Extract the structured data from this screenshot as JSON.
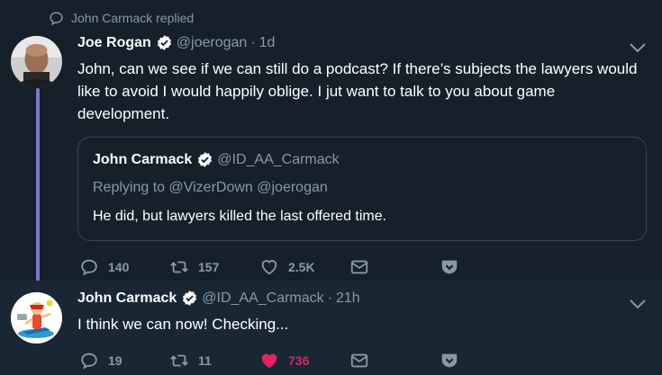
{
  "context": {
    "icon": "reply-bubble-icon",
    "text": "John Carmack replied"
  },
  "tweet1": {
    "name": "Joe Rogan",
    "handle": "@joerogan",
    "separator": "·",
    "time": "1d",
    "verified": true,
    "text": "John, can we see if we can still do a podcast? If there’s subjects the lawyers would like to avoid I would happily oblige. I jut want to talk to you about game development.",
    "quote": {
      "name": "John Carmack",
      "handle": "@ID_AA_Carmack",
      "reply_label": "Replying to @VizerDown @joerogan",
      "text": "He did, but lawyers killed the last offered time."
    },
    "actions": {
      "replies": "140",
      "retweets": "157",
      "likes": "2.5K"
    }
  },
  "tweet2": {
    "name": "John Carmack",
    "handle": "@ID_AA_Carmack",
    "separator": "·",
    "time": "21h",
    "verified": true,
    "text": "I think we can now!  Checking...",
    "actions": {
      "replies": "19",
      "retweets": "11",
      "likes": "736",
      "liked": true
    }
  },
  "colors": {
    "background": "#15202b",
    "secondary_text": "#8899a6",
    "verified_badge": "#ffffff",
    "thread_line": "#8177c6",
    "like_active": "#e0245e"
  }
}
